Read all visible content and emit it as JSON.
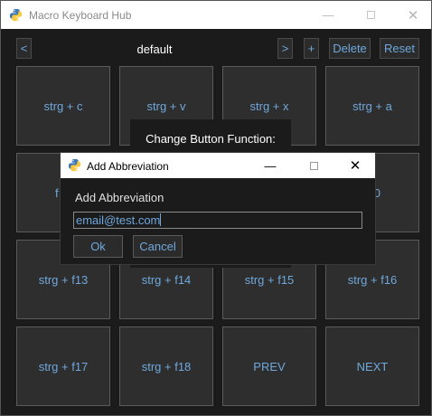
{
  "window": {
    "title": "Macro Keyboard Hub"
  },
  "toolbar": {
    "prev_label": "<",
    "profile_name": "default",
    "next_label": ">",
    "add_label": "+",
    "delete_label": "Delete",
    "reset_label": "Reset"
  },
  "grid": {
    "buttons": [
      "strg + c",
      "strg + v",
      "strg + x",
      "strg + a",
      "f",
      "",
      "",
      "0",
      "strg + f13",
      "strg + f14",
      "strg + f15",
      "strg + f16",
      "strg + f17",
      "strg + f18",
      "PREV",
      "NEXT"
    ]
  },
  "popup": {
    "caption": "Change Button Function:"
  },
  "dialog": {
    "title": "Add Abbreviation",
    "prompt": "Add Abbreviation",
    "input_value": "email@test.com",
    "ok_label": "Ok",
    "cancel_label": "Cancel"
  },
  "colors": {
    "accent": "#6fa8dc",
    "background": "#1b1b1b",
    "button": "#2e2e2e"
  }
}
